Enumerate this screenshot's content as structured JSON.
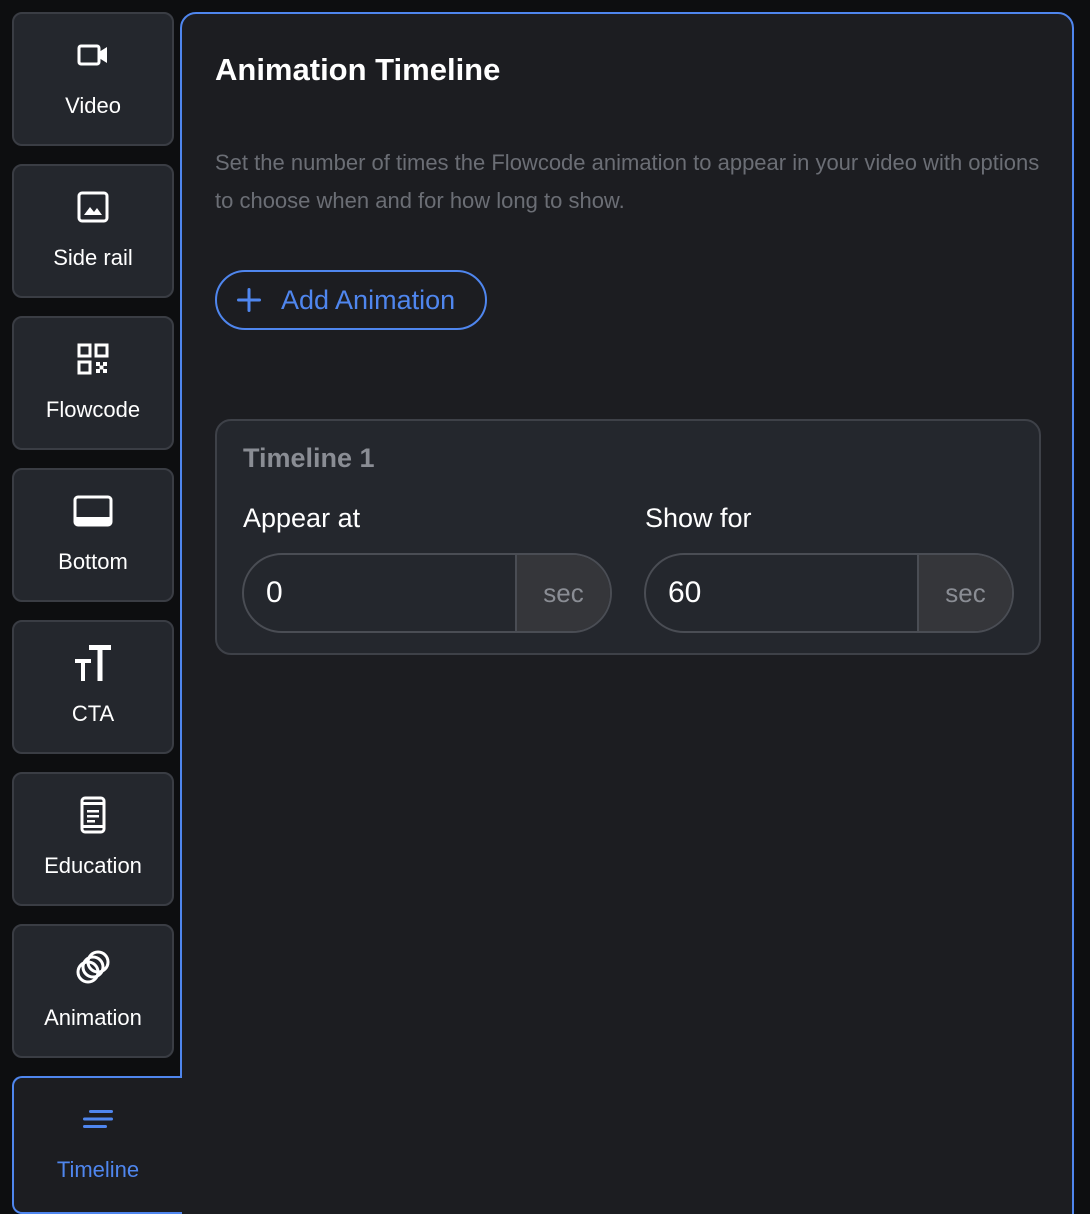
{
  "sidebar": {
    "items": [
      {
        "label": "Video",
        "icon": "video-camera-icon"
      },
      {
        "label": "Side rail",
        "icon": "image-icon"
      },
      {
        "label": "Flowcode",
        "icon": "qr-code-icon"
      },
      {
        "label": "Bottom",
        "icon": "monitor-icon"
      },
      {
        "label": "CTA",
        "icon": "text-size-icon"
      },
      {
        "label": "Education",
        "icon": "mobile-document-icon"
      },
      {
        "label": "Animation",
        "icon": "rings-icon"
      },
      {
        "label": "Timeline",
        "icon": "timeline-lines-icon",
        "active": true
      }
    ]
  },
  "panel": {
    "title": "Animation Timeline",
    "description": "Set the number of times the Flowcode animation to appear in your video with options to choose when and for how long to show.",
    "add_button_label": "Add Animation",
    "timeline": {
      "title": "Timeline 1",
      "appear_at": {
        "label": "Appear at",
        "value": "0",
        "unit": "sec"
      },
      "show_for": {
        "label": "Show for",
        "value": "60",
        "unit": "sec"
      }
    }
  },
  "colors": {
    "accent": "#4f86ee",
    "panel_bg": "#1c1d21",
    "card_bg": "#24272d",
    "muted_text": "#6b6e75"
  }
}
